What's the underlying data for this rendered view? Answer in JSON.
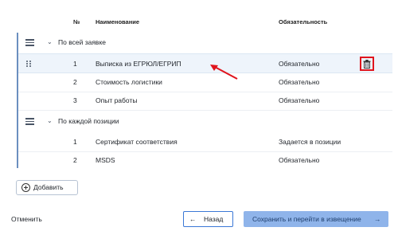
{
  "table": {
    "headers": {
      "num": "№",
      "name": "Наименование",
      "required": "Обязательность"
    },
    "groups": [
      {
        "title": "По всей заявке",
        "items": [
          {
            "num": "1",
            "name": "Выписка из ЕГРЮЛ/ЕГРИП",
            "required": "Обязательно"
          },
          {
            "num": "2",
            "name": "Стоимость логистики",
            "required": "Обязательно"
          },
          {
            "num": "3",
            "name": "Опыт работы",
            "required": "Обязательно"
          }
        ]
      },
      {
        "title": "По каждой позиции",
        "items": [
          {
            "num": "1",
            "name": "Сертификат соответствия",
            "required": "Задается в позиции"
          },
          {
            "num": "2",
            "name": "MSDS",
            "required": "Обязательно"
          }
        ]
      }
    ]
  },
  "actions": {
    "add_label": "Добавить",
    "cancel_label": "Отменить",
    "back_label": "Назад",
    "save_label": "Сохранить и перейти в извещение"
  },
  "colors": {
    "accent": "#3b78d6",
    "highlight": "#e0141d",
    "primary_disabled": "#8fb4ea"
  },
  "icons": {
    "add": "plus-circle-icon",
    "back": "arrow-left-icon",
    "next": "arrow-right-icon",
    "delete": "trash-icon",
    "drag": "drag-handle-icon",
    "group": "list-icon",
    "collapse": "chevron-down-icon"
  }
}
